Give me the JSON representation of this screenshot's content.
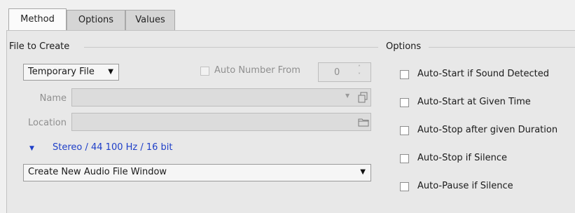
{
  "tabs": [
    {
      "label": "Method",
      "active": true
    },
    {
      "label": "Options",
      "active": false
    },
    {
      "label": "Values",
      "active": false
    }
  ],
  "file_to_create": {
    "title": "File to Create",
    "type_dropdown": {
      "value": "Temporary File"
    },
    "auto_number": {
      "label": "Auto Number From",
      "checked": false,
      "enabled": false,
      "value": "0"
    },
    "name": {
      "label": "Name",
      "value": "",
      "enabled": false
    },
    "location": {
      "label": "Location",
      "value": "",
      "enabled": false
    },
    "format": {
      "text": "Stereo / 44 100 Hz / 16 bit"
    },
    "action_dropdown": {
      "value": "Create New Audio File Window"
    }
  },
  "options": {
    "title": "Options",
    "items": [
      {
        "label": "Auto-Start if Sound Detected",
        "checked": false
      },
      {
        "label": "Auto-Start at Given Time",
        "checked": false
      },
      {
        "label": "Auto-Stop after given Duration",
        "checked": false
      },
      {
        "label": "Auto-Stop if Silence",
        "checked": false
      },
      {
        "label": "Auto-Pause if Silence",
        "checked": false
      }
    ]
  },
  "colors": {
    "accent": "#1e3fc8",
    "panel": "#e8e8e8"
  },
  "icons": {
    "dropdown": "triangle-down-icon",
    "copy": "copy-icon",
    "folder": "folder-icon",
    "expand": "triangle-down-icon"
  }
}
